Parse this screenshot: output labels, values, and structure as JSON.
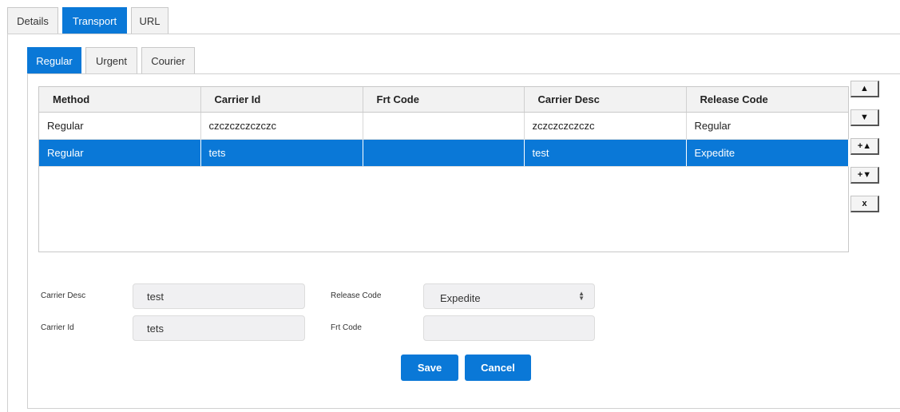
{
  "main_tabs": [
    "Details",
    "Transport",
    "URL"
  ],
  "sub_tabs": [
    "Regular",
    "Urgent",
    "Courier"
  ],
  "grid": {
    "columns": [
      "Method",
      "Carrier Id",
      "Frt Code",
      "Carrier Desc",
      "Release Code"
    ],
    "rows": [
      [
        "Regular",
        "czczczczczczc",
        "",
        "zczczczczczc",
        "Regular"
      ],
      [
        "Regular",
        "tets",
        "",
        "test",
        "Expedite"
      ]
    ]
  },
  "side_buttons": [
    "▲",
    "▼",
    "+▲",
    "+▼",
    "x"
  ],
  "form": {
    "carrier_desc_label": "Carrier Desc",
    "carrier_desc_value": "test",
    "carrier_id_label": "Carrier Id",
    "carrier_id_value": "tets",
    "release_code_label": "Release Code",
    "release_code_value": "Expedite",
    "frt_code_label": "Frt Code",
    "frt_code_value": ""
  },
  "actions": {
    "save": "Save",
    "cancel": "Cancel"
  },
  "colors": {
    "accent": "#0a78d7"
  }
}
